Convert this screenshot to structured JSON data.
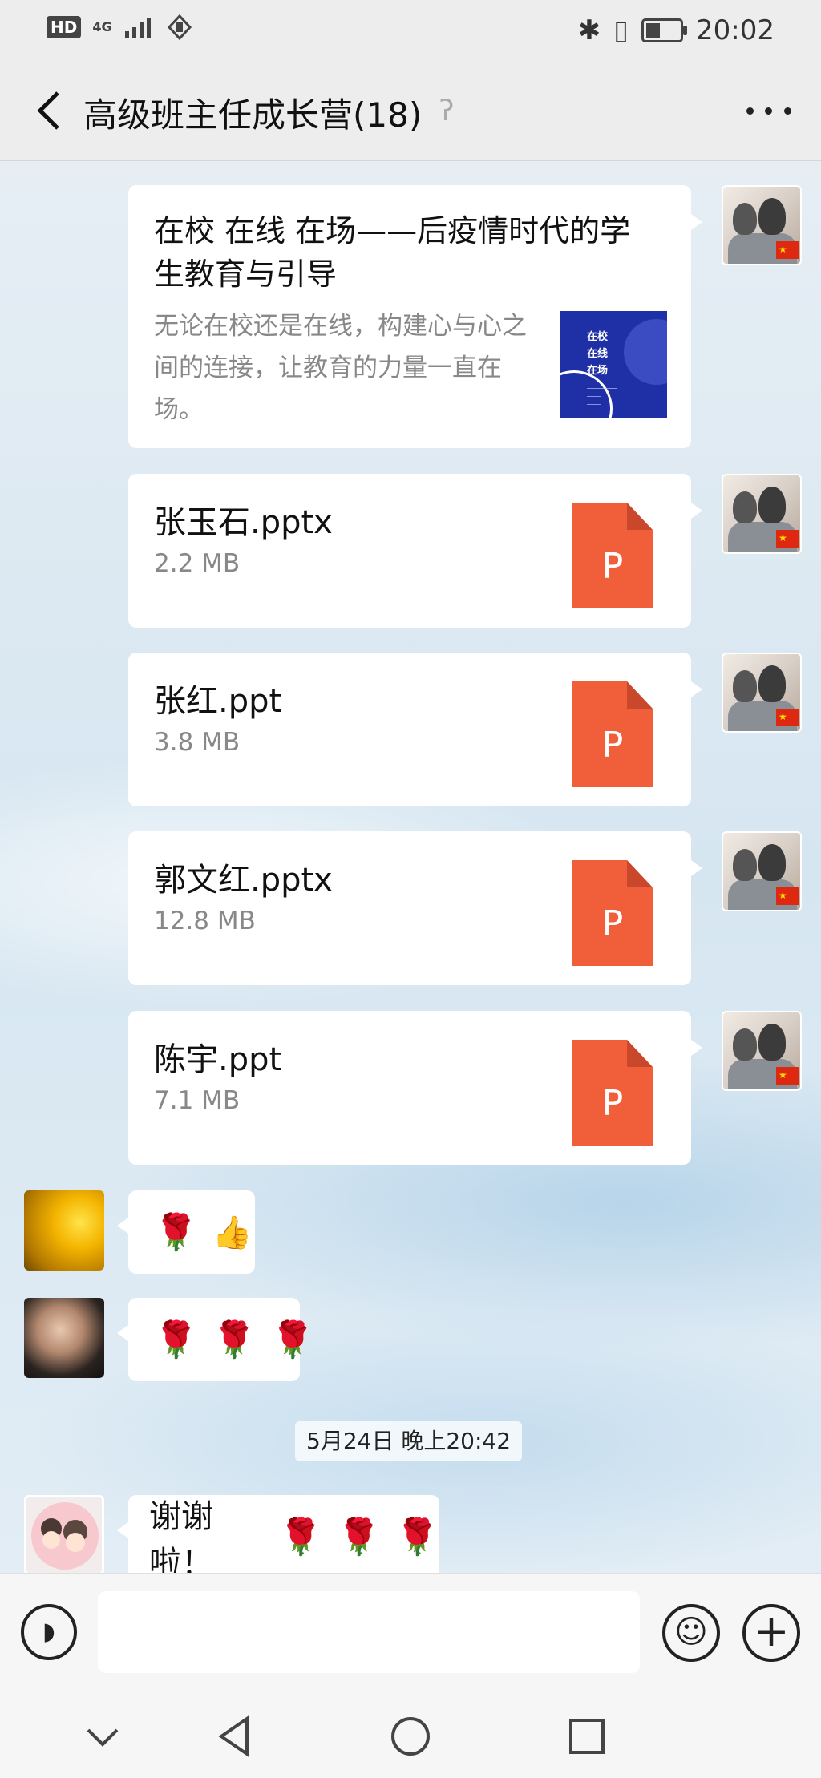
{
  "status_bar": {
    "hd": "HD",
    "network": "4G",
    "time": "20:02"
  },
  "header": {
    "title": "高级班主任成长营(18)",
    "mute_icon": "ear-mute-icon"
  },
  "messages": {
    "link": {
      "title": "在校 在线 在场——后疫情时代的学生教育与引导",
      "description": "无论在校还是在线，构建心与心之间的连接，让教育的力量一直在场。",
      "thumb_lines": [
        "在校",
        "在线",
        "在场"
      ]
    },
    "files": [
      {
        "name": "张玉石.pptx",
        "size": "2.2 MB",
        "icon_letter": "P"
      },
      {
        "name": "张红.ppt",
        "size": "3.8 MB",
        "icon_letter": "P"
      },
      {
        "name": "郭文红.pptx",
        "size": "12.8 MB",
        "icon_letter": "P"
      },
      {
        "name": "陈宇.ppt",
        "size": "7.1 MB",
        "icon_letter": "P"
      }
    ],
    "emoji_msg_1": {
      "rose": "🌹",
      "thumbs": "👍"
    },
    "emoji_msg_2": {
      "rose": "🌹"
    },
    "timestamp": "5月24日 晚上20:42",
    "text_msg": {
      "text": "谢谢啦！",
      "rose": "🌹"
    }
  },
  "input_bar": {
    "placeholder": "",
    "voice_icon": "voice-icon",
    "emoji_icon": "emoji-icon",
    "plus_icon": "plus-icon"
  },
  "colors": {
    "ppt_orange": "#f15e3a",
    "chat_bg": "#dfe9f1",
    "bar_bg": "#ededed"
  }
}
